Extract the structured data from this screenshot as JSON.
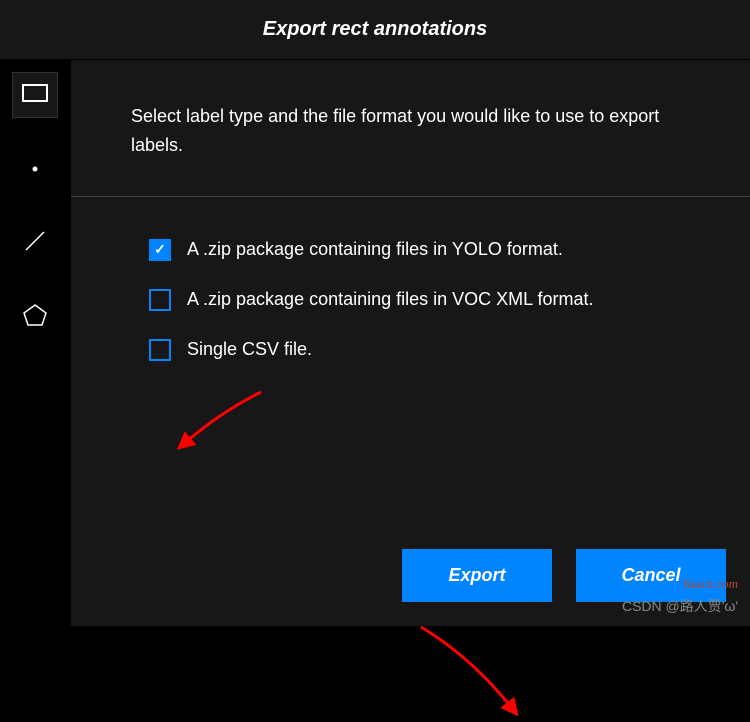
{
  "header": {
    "title": "Export rect annotations"
  },
  "instruction": {
    "text": "Select label type and the file format you would like to use to export labels."
  },
  "options": [
    {
      "label": "A .zip package containing files in YOLO format.",
      "checked": true
    },
    {
      "label": "A .zip package containing files in VOC XML format.",
      "checked": false
    },
    {
      "label": "Single CSV file.",
      "checked": false
    }
  ],
  "buttons": {
    "export": "Export",
    "cancel": "Cancel"
  },
  "watermarks": {
    "site": "Yuucn.com",
    "author": "CSDN @路人贾'ω'"
  },
  "colors": {
    "accent": "#0084ff",
    "background": "#171717",
    "arrow": "#ff0000"
  }
}
